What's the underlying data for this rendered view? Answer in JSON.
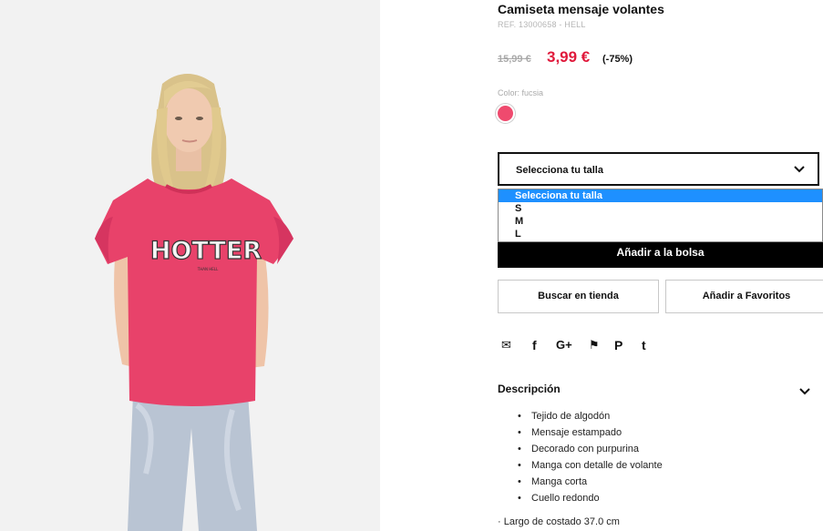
{
  "product": {
    "title": "Camiseta mensaje volantes",
    "ref": "REF. 13000658 - HELL",
    "price": {
      "old": "15,99 €",
      "new": "3,99 €",
      "discount": "(-75%)"
    },
    "color_label": "Color: fucsia",
    "swatch_color": "#ef4a6e",
    "shirt_print": {
      "headline": "HOTTER",
      "subline": "THAN HELL"
    }
  },
  "size_select": {
    "value": "Selecciona tu talla",
    "options": [
      "Selecciona tu talla",
      "S",
      "M",
      "L"
    ]
  },
  "actions": {
    "add_to_bag": "Añadir a la bolsa",
    "find_in_store": "Buscar en tienda",
    "add_to_favorites": "Añadir a Favoritos"
  },
  "social": [
    {
      "icon": "mail-icon",
      "glyph": "✉"
    },
    {
      "icon": "facebook-icon",
      "glyph": "f"
    },
    {
      "icon": "google-plus-icon",
      "glyph": "G+"
    },
    {
      "icon": "twitter-icon",
      "glyph": "⚑"
    },
    {
      "icon": "pinterest-icon",
      "glyph": "P"
    },
    {
      "icon": "tumblr-icon",
      "glyph": "t"
    }
  ],
  "description": {
    "title": "Descripción",
    "items": [
      "Tejido de algodón",
      "Mensaje estampado",
      "Decorado con purpurina",
      "Manga con detalle de volante",
      "Manga corta",
      "Cuello redondo"
    ],
    "extra": "· Largo de costado 37.0 cm"
  },
  "colors": {
    "sale_red": "#e0193b",
    "shirt_pink": "#e8426a",
    "select_highlight": "#1e90ff"
  }
}
